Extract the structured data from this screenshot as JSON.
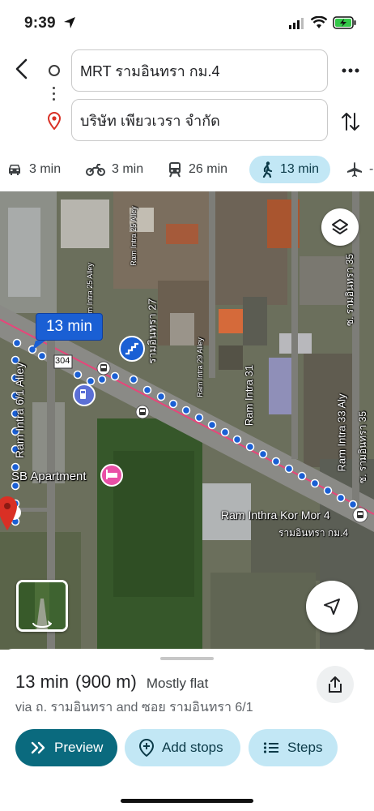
{
  "status_bar": {
    "time": "9:39"
  },
  "route": {
    "origin": "MRT รามอินทรา กม.4",
    "destination": "บริษัท เพียวเวรา จำกัด"
  },
  "modes": [
    {
      "icon": "car-icon",
      "label": "3 min"
    },
    {
      "icon": "motorcycle-icon",
      "label": "3 min"
    },
    {
      "icon": "transit-icon",
      "label": "26 min"
    },
    {
      "icon": "walk-icon",
      "label": "13 min",
      "active": true
    },
    {
      "icon": "flight-icon",
      "label": "-"
    }
  ],
  "map": {
    "time_bubble": "13 min",
    "labels": {
      "ram_intra_61": "Ram Intra 6/1 Alley",
      "ram_intra_25": "Ram Intra 25 Alley",
      "ram_intra_27": "รามอินทรา 27",
      "ram_intra_29": "Ram Intra 29 Alley",
      "ram_intra_31": "Ram Intra 31",
      "ram_intra_33": "Ram Intra 33 Aly",
      "thai_35_top": "ซ. รามอินทรา 35",
      "thai_35_bottom": "ซ. รามอินทรา 35",
      "sb_apartment": "SB Apartment",
      "station_en": "Ram Inthra Kor Mor 4",
      "station_th": "รามอินทรา กม.4",
      "road_shield": "304"
    },
    "route_color": "#1a5fd4",
    "road_line_color": "#e8457a"
  },
  "summary": {
    "duration": "13 min",
    "distance": "(900 m)",
    "terrain": "Mostly flat",
    "via": "via ถ. รามอินทรา and ซอย รามอินทรา 6/1"
  },
  "actions": {
    "preview": "Preview",
    "add_stops": "Add stops",
    "steps": "Steps"
  },
  "colors": {
    "accent": "#0a6a7e",
    "chip_bg": "#c2e7f5"
  }
}
